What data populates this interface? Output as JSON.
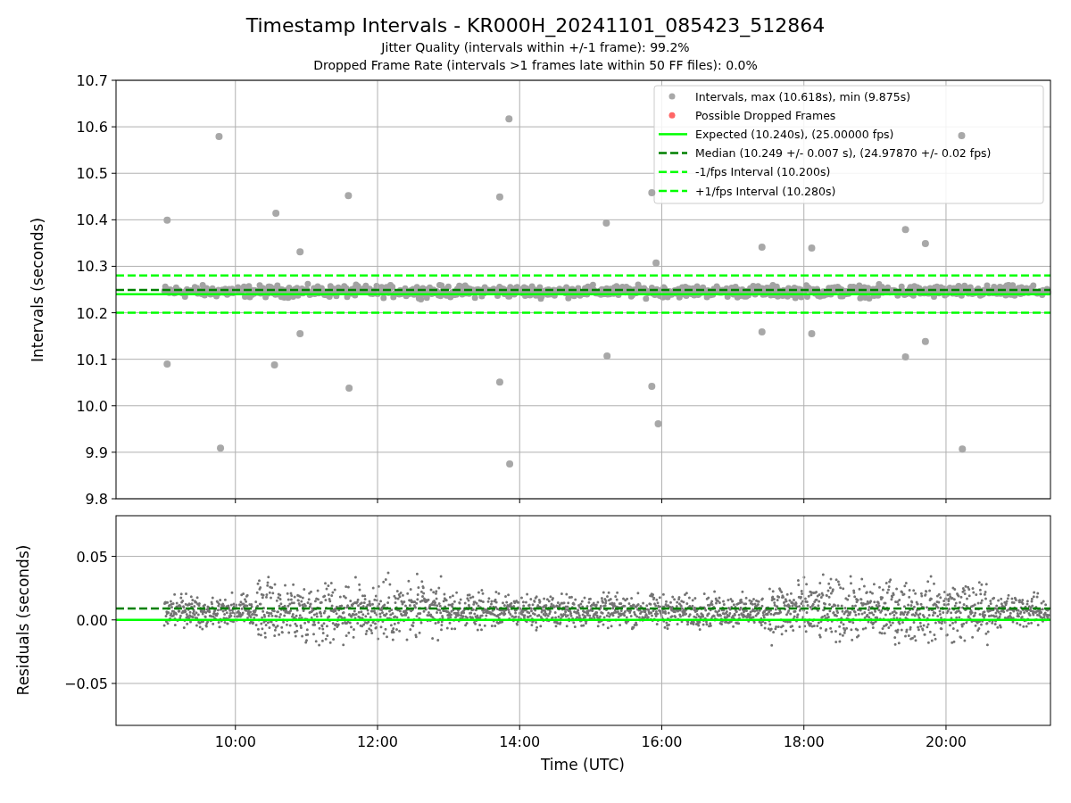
{
  "figure": {
    "title": "Timestamp Intervals - KR000H_20241101_085423_512864",
    "subtitles": [
      "Jitter Quality (intervals within +/-1 frame): 99.2%",
      "Dropped Frame Rate (intervals >1 frames late within 50 FF files): 0.0%"
    ]
  },
  "plots": [
    {
      "kind": "intervals",
      "chart_data": {
        "type": "scatter",
        "ylabel": "Intervals (seconds)",
        "xlim": [
          8.32,
          21.47
        ],
        "ylim": [
          9.8,
          10.7
        ],
        "grid": true,
        "legend": true,
        "yticks": [
          {
            "value": 9.8,
            "label": "9.8"
          },
          {
            "value": 9.9,
            "label": "9.9"
          },
          {
            "value": 10.0,
            "label": "10.0"
          },
          {
            "value": 10.1,
            "label": "10.1"
          },
          {
            "value": 10.2,
            "label": "10.2"
          },
          {
            "value": 10.3,
            "label": "10.3"
          },
          {
            "value": 10.4,
            "label": "10.4"
          },
          {
            "value": 10.5,
            "label": "10.5"
          },
          {
            "value": 10.6,
            "label": "10.6"
          },
          {
            "value": 10.7,
            "label": "10.7"
          }
        ],
        "series": [
          {
            "name": "Intervals, max (10.618s), min (9.875s)",
            "color": "#a8a8a8",
            "x": [
              9.04,
              9.04,
              9.77,
              9.79,
              10.57,
              10.55,
              10.91,
              10.91,
              11.59,
              11.6,
              13.72,
              13.72,
              13.85,
              13.86,
              15.22,
              15.23,
              15.86,
              15.86,
              15.92,
              15.95,
              17.41,
              17.41,
              18.11,
              18.11,
              19.43,
              19.43,
              19.71,
              19.71,
              20.22,
              20.23
            ],
            "values": [
              10.399,
              10.09,
              10.579,
              9.909,
              10.414,
              10.088,
              10.331,
              10.155,
              10.452,
              10.038,
              10.449,
              10.051,
              10.617,
              9.875,
              10.393,
              10.107,
              10.458,
              10.042,
              10.307,
              9.961,
              10.341,
              10.159,
              10.339,
              10.155,
              10.379,
              10.105,
              10.349,
              10.138,
              10.581,
              9.907
            ]
          },
          {
            "name": "Possible Dropped Frames",
            "color": "#ff6666"
          },
          {
            "name": "Expected (10.240s), (25.00000 fps)",
            "type": "line",
            "color": "#00ff00",
            "line_style": "solid",
            "x": [
              8.32,
              21.47
            ],
            "values": [
              10.24,
              10.24
            ]
          },
          {
            "name": "Median (10.249 +/- 0.007 s), (24.97870 +/- 0.02 fps)",
            "type": "line",
            "color": "#008000",
            "line_style": "dashed",
            "x": [
              8.32,
              21.47
            ],
            "values": [
              10.249,
              10.249
            ]
          },
          {
            "name": "-1/fps Interval (10.200s)",
            "type": "line",
            "color": "#00ff00",
            "line_style": "dashed",
            "x": [
              8.32,
              21.47
            ],
            "values": [
              10.2,
              10.2
            ]
          },
          {
            "name": "+1/fps Interval (10.280s)",
            "type": "line",
            "color": "#00ff00",
            "line_style": "dashed",
            "x": [
              8.32,
              21.47
            ],
            "values": [
              10.28,
              10.28
            ]
          }
        ]
      }
    },
    {
      "kind": "residuals",
      "chart_data": {
        "type": "line",
        "xlabel": "Time (UTC)",
        "ylabel": "Residuals (seconds)",
        "xlim": [
          8.32,
          21.47
        ],
        "ylim": [
          -0.083,
          0.082
        ],
        "grid": true,
        "xticks": [
          {
            "value": 10,
            "label": "10:00"
          },
          {
            "value": 12,
            "label": "12:00"
          },
          {
            "value": 14,
            "label": "14:00"
          },
          {
            "value": 16,
            "label": "16:00"
          },
          {
            "value": 18,
            "label": "18:00"
          },
          {
            "value": 20,
            "label": "20:00"
          }
        ],
        "yticks": [
          {
            "value": 0.05,
            "label": "0.05"
          },
          {
            "value": 0,
            "label": "0.00"
          },
          {
            "value": -0.05,
            "label": "−0.05"
          }
        ],
        "series": [
          {
            "color": "#00ff00",
            "line_style": "solid",
            "x": [
              8.32,
              21.47
            ],
            "values": [
              0,
              0
            ]
          },
          {
            "color": "#008000",
            "line_style": "dashed",
            "x": [
              8.32,
              21.47
            ],
            "values": [
              0.009,
              0.009
            ]
          }
        ]
      }
    }
  ]
}
